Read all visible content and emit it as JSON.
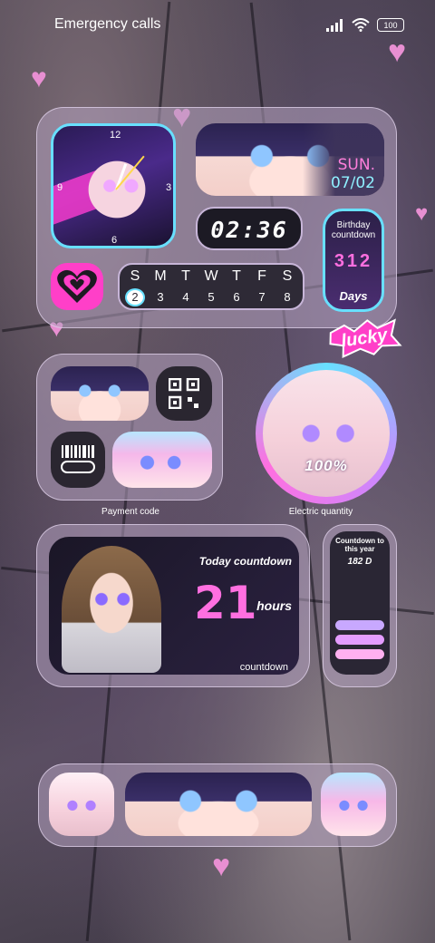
{
  "status_bar": {
    "carrier_text": "Emergency calls",
    "battery": "100"
  },
  "clock_widget": {
    "numbers": [
      "12",
      "3",
      "6",
      "9"
    ]
  },
  "date_widget": {
    "day": "SUN.",
    "date": "07/02"
  },
  "time_widget": {
    "time": "02:36"
  },
  "birthday_widget": {
    "title": "Birthday countdown",
    "value": "312",
    "unit": "Days"
  },
  "calendar_widget": {
    "weekdays": [
      "S",
      "M",
      "T",
      "W",
      "T",
      "F",
      "S"
    ],
    "dates": [
      "2",
      "3",
      "4",
      "5",
      "6",
      "7",
      "8"
    ],
    "selected_index": 0
  },
  "sticker": {
    "lucky": "lucky"
  },
  "payment_widget": {
    "label": "Payment code"
  },
  "battery_widget": {
    "value": "100%",
    "label": "Electric quantity"
  },
  "countdown_widget": {
    "title": "Today countdown",
    "value": "21",
    "unit": "hours",
    "footer": "countdown"
  },
  "year_widget": {
    "title": "Countdown to this year",
    "value": "182 D"
  },
  "colors": {
    "panel": "#b2a0be",
    "accent_pink": "#ff5fd0",
    "accent_cyan": "#68e0ff",
    "heart": "#e88fd2"
  }
}
